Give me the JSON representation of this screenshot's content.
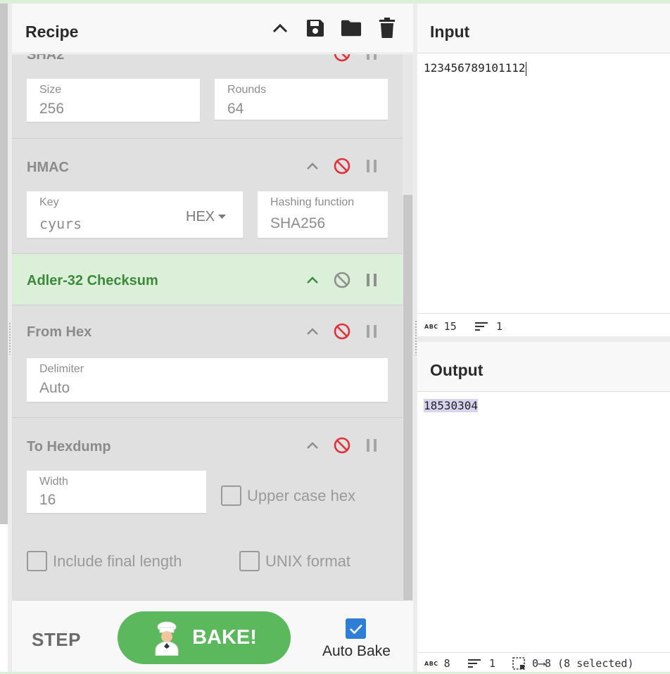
{
  "recipe": {
    "title": "Recipe",
    "operations": [
      {
        "name": "SHA2",
        "fields": [
          {
            "label": "Size",
            "value": "256"
          },
          {
            "label": "Rounds",
            "value": "64"
          }
        ]
      },
      {
        "name": "HMAC",
        "fields": [
          {
            "label": "Key",
            "value": "cyurs",
            "format": "HEX"
          },
          {
            "label": "Hashing function",
            "value": "SHA256"
          }
        ]
      },
      {
        "name": "Adler-32 Checksum",
        "highlighted": true
      },
      {
        "name": "From Hex",
        "fields": [
          {
            "label": "Delimiter",
            "value": "Auto"
          }
        ]
      },
      {
        "name": "To Hexdump",
        "fields": [
          {
            "label": "Width",
            "value": "16"
          }
        ],
        "checkboxes": [
          {
            "label": "Upper case hex",
            "checked": false
          },
          {
            "label": "Include final length",
            "checked": false
          },
          {
            "label": "UNIX format",
            "checked": false
          }
        ]
      }
    ]
  },
  "controls": {
    "step_label": "STEP",
    "bake_label": "BAKE!",
    "auto_bake_label": "Auto Bake",
    "auto_bake_checked": true
  },
  "input": {
    "title": "Input",
    "text": "123456789101112",
    "status": {
      "abc_label": "ABC",
      "length": "15",
      "lines": "1"
    }
  },
  "output": {
    "title": "Output",
    "text": "18530304",
    "status": {
      "abc_label": "ABC",
      "length": "8",
      "lines": "1",
      "selection": "0⟶8 (8 selected)"
    }
  },
  "colors": {
    "accent_green": "#5cb85c",
    "highlight_green": "#dcefd8",
    "disable_red": "#e0303a",
    "checkbox_blue": "#2e7dd6"
  }
}
